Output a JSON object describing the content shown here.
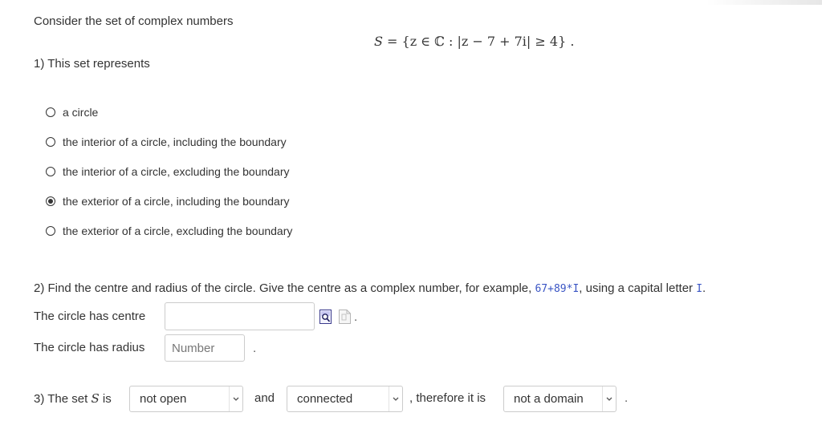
{
  "intro": "Consider the set of complex numbers",
  "set_expression": {
    "lhs": "S",
    "rest": " = {z ∈ ℂ : |z − 7 + 7i| ≥ 4} ."
  },
  "question1": {
    "prompt": "1) This set represents",
    "options": [
      {
        "label": "a circle",
        "selected": false
      },
      {
        "label": "the interior of a circle, including the boundary",
        "selected": false
      },
      {
        "label": "the interior of a circle, excluding the boundary",
        "selected": false
      },
      {
        "label": "the exterior of a circle, including the boundary",
        "selected": true
      },
      {
        "label": "the exterior of a circle, excluding the boundary",
        "selected": false
      }
    ]
  },
  "question2": {
    "prompt_before": "2) Find the centre and radius of the circle.  Give the centre as a complex number, for example, ",
    "example_code": "67+89*I",
    "prompt_middle": ", using a capital letter ",
    "capital_code": "I",
    "prompt_end": ".",
    "centre_label": "The circle has centre",
    "centre_value": "",
    "centre_after": ".",
    "radius_label": "The circle has radius",
    "radius_placeholder": "Number",
    "radius_after": "."
  },
  "question3": {
    "prompt_prefix": "3) The set ",
    "set_symbol": "S",
    "prompt_is": " is",
    "select1": "not open",
    "and_label": "and",
    "select2": "connected",
    "therefore_label": ", therefore it is",
    "select3": "not a domain",
    "end": "."
  },
  "icons": {
    "preview": "preview-icon",
    "help": "help-icon",
    "chevron": "chevron-down-icon"
  },
  "colors": {
    "text": "#333333",
    "code": "#3a55c4",
    "border": "#cccccc"
  }
}
